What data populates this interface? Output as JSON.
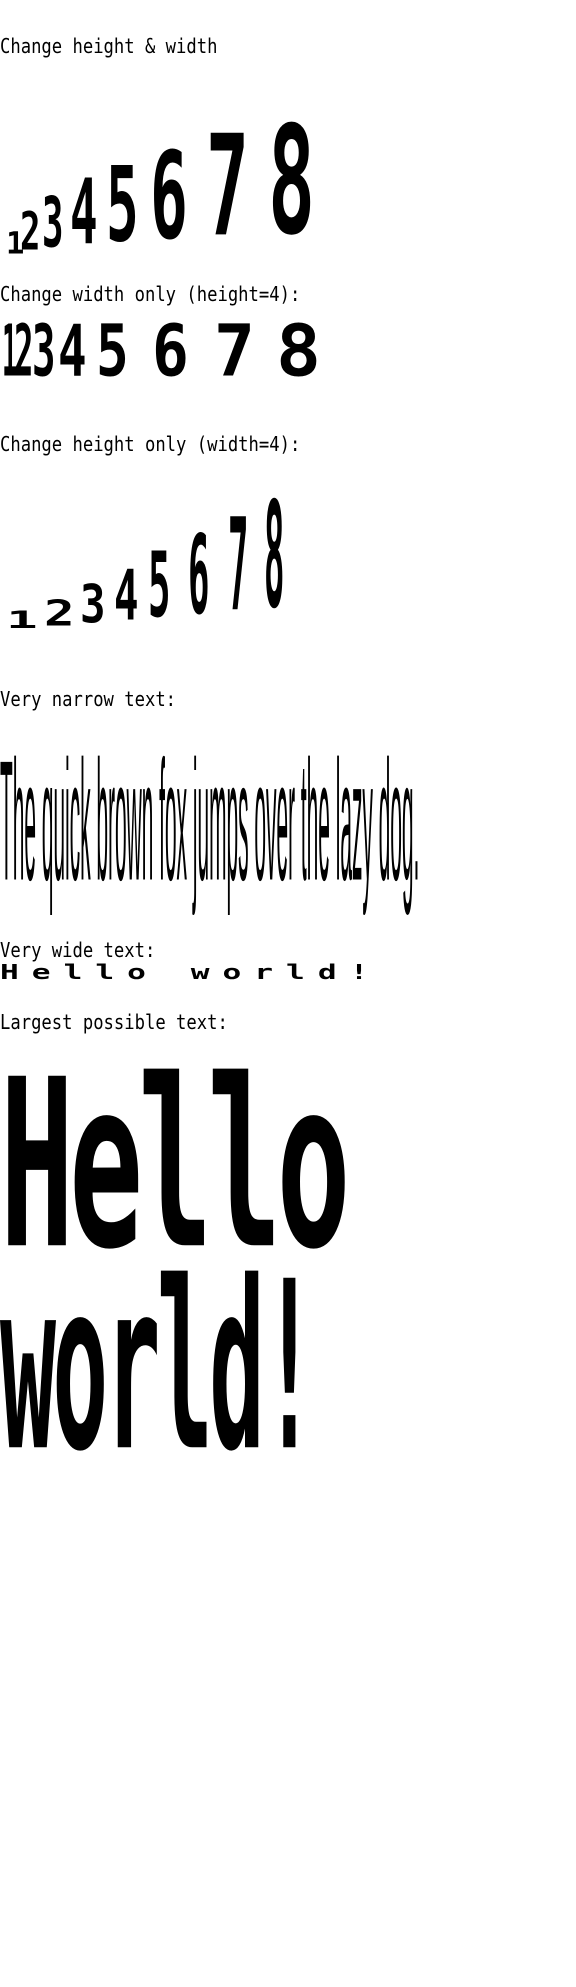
{
  "sections": {
    "s1_label": "Change height & width",
    "s2_label": "Change width only (height=4):",
    "s3_label": "Change height only (width=4):",
    "s4_label": "Very narrow text:",
    "s5_label": "Very wide text:",
    "s6_label": "Largest possible text:"
  },
  "digits": [
    "1",
    "2",
    "3",
    "4",
    "5",
    "6",
    "7",
    "8"
  ],
  "narrow_text": "The quick brown fox jumps over the lazy dog.",
  "wide_text": "Hello world!",
  "largest_line1": "Hello",
  "largest_line2": "world!"
}
